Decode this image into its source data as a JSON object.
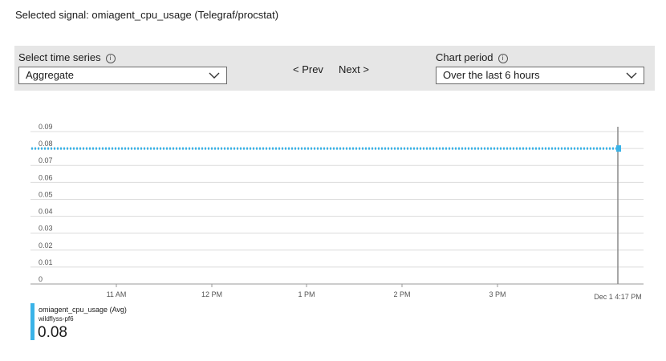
{
  "header": {
    "title": "Selected signal: omiagent_cpu_usage (Telegraf/procstat)"
  },
  "toolbar": {
    "time_series_label": "Select time series",
    "time_series_value": "Aggregate",
    "prev_label": "< Prev",
    "next_label": "Next >",
    "chart_period_label": "Chart period",
    "chart_period_value": "Over the last 6 hours",
    "info_glyph": "i"
  },
  "chart_data": {
    "type": "line",
    "y_ticks": [
      "0.09",
      "0.08",
      "0.07",
      "0.06",
      "0.05",
      "0.04",
      "0.03",
      "0.02",
      "0.01",
      "0"
    ],
    "ylim": [
      0,
      0.09
    ],
    "x_ticks": [
      "11 AM",
      "12 PM",
      "1 PM",
      "2 PM",
      "3 PM"
    ],
    "x_end_label": "Dec 1 4:17 PM",
    "grid": true,
    "series": [
      {
        "name": "omiagent_cpu_usage (Avg)",
        "style": "dotted",
        "color": "#3ab3e8",
        "value": 0.08
      }
    ]
  },
  "legend": {
    "series_name": "omiagent_cpu_usage (Avg)",
    "resource": "wildflyss-pf6",
    "value": "0.08",
    "color": "#3ab3e8"
  }
}
